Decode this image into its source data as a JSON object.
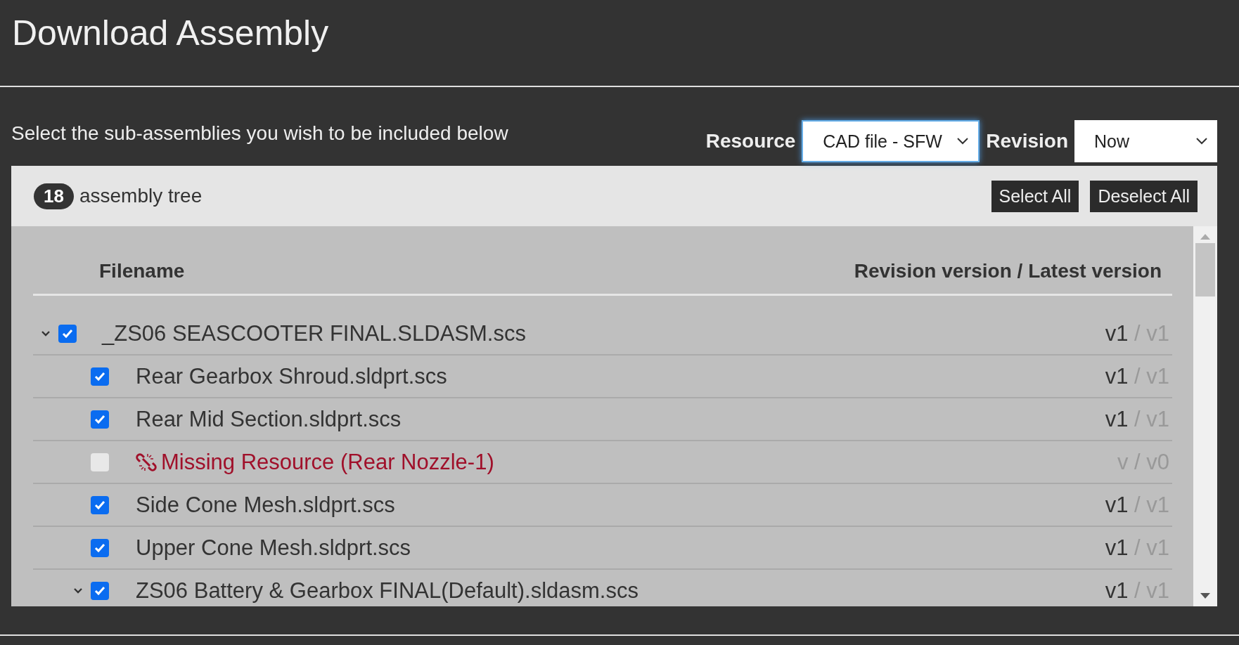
{
  "title": "Download Assembly",
  "instruction": "Select the sub-assemblies you wish to be included below",
  "resource": {
    "label": "Resource",
    "value": "CAD file - SFW",
    "focused": true
  },
  "revision": {
    "label": "Revision",
    "value": "Now",
    "focused": false
  },
  "panel": {
    "count": "18",
    "label": "assembly tree",
    "buttons": [
      "Select All",
      "Deselect All"
    ]
  },
  "table": {
    "columns": [
      "Filename",
      "Revision version / Latest version"
    ],
    "rows": [
      {
        "kind": "file",
        "name": "_ZS06 SEASCOOTER FINAL.SLDASM.scs",
        "checked": true,
        "expanded": true,
        "revision": "v1",
        "separator": "/",
        "latest": "v1",
        "children": [
          {
            "kind": "file",
            "name": "Rear Gearbox Shroud.sldprt.scs",
            "checked": true,
            "revision": "v1",
            "separator": "/",
            "latest": "v1"
          },
          {
            "kind": "file",
            "name": "Rear Mid Section.sldprt.scs",
            "checked": true,
            "revision": "v1",
            "separator": "/",
            "latest": "v1"
          },
          {
            "kind": "missing",
            "name": "Missing Resource (Rear Nozzle-1)",
            "checked": false,
            "revision": "v",
            "separator": "/",
            "latest": "v0"
          },
          {
            "kind": "file",
            "name": "Side Cone Mesh.sldprt.scs",
            "checked": true,
            "revision": "v1",
            "separator": "/",
            "latest": "v1"
          },
          {
            "kind": "file",
            "name": "Upper Cone Mesh.sldprt.scs",
            "checked": true,
            "revision": "v1",
            "separator": "/",
            "latest": "v1"
          },
          {
            "kind": "file",
            "name": "ZS06 Battery & Gearbox FINAL(Default).sldasm.scs",
            "checked": true,
            "expanded": true,
            "revision": "v1",
            "separator": "/",
            "latest": "v1"
          }
        ]
      }
    ]
  }
}
